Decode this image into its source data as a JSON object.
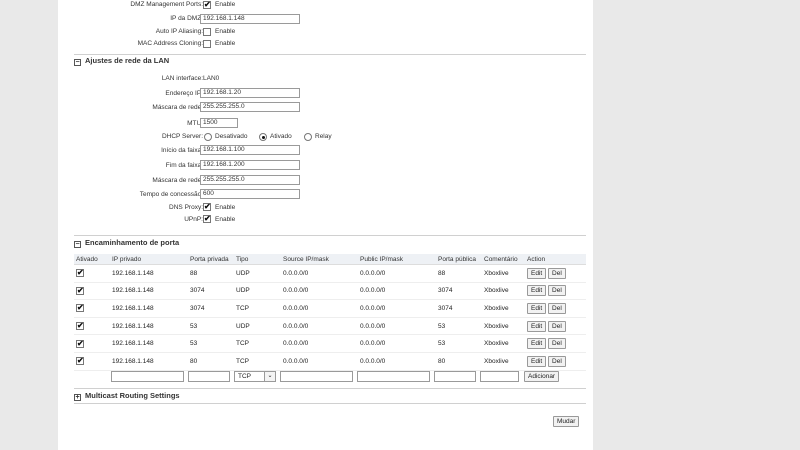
{
  "dmz": {
    "mgmt_label": "DMZ Management Ports:",
    "mgmt_enable": "Enable",
    "ip_label": "IP da DMZ:",
    "ip_value": "192.168.1.148",
    "auto_ip_label": "Auto IP Aliasing:",
    "auto_ip_enable": "Enable",
    "mac_label": "MAC Address Cloning:",
    "mac_enable": "Enable"
  },
  "lan": {
    "section_title": "Ajustes de rede da LAN",
    "interface_label": "LAN interface:",
    "interface_value": "LAN0",
    "ip_label": "Endereço IP:",
    "ip_value": "192.168.1.20",
    "mask_label": "Máscara de rede:",
    "mask_value": "255.255.255.0",
    "mtu_label": "MTU:",
    "mtu_value": "1500",
    "dhcp_label": "DHCP Server:",
    "dhcp_options": [
      "Desativado",
      "Ativado",
      "Relay"
    ],
    "dhcp_selected": "Ativado",
    "start_label": "Início da faixa:",
    "start_value": "192.168.1.100",
    "end_label": "Fim da faixa:",
    "end_value": "192.168.1.200",
    "dhcp_mask_label": "Máscara de rede:",
    "dhcp_mask_value": "255.255.255.0",
    "lease_label": "Tempo de concessão:",
    "lease_value": "600",
    "dns_label": "DNS Proxy:",
    "dns_enable": "Enable",
    "upnp_label": "UPnP:",
    "upnp_enable": "Enable"
  },
  "portfwd": {
    "section_title": "Encaminhamento de porta",
    "headers": [
      "Ativado",
      "IP privado",
      "Porta privada",
      "Tipo",
      "Source IP/mask",
      "Public IP/mask",
      "Porta pública",
      "Comentário",
      "Action"
    ],
    "rows": [
      {
        "ip": "192.168.1.148",
        "priv_port": "88",
        "type": "UDP",
        "src": "0.0.0.0/0",
        "pub": "0.0.0.0/0",
        "pub_port": "88",
        "comment": "Xboxlive",
        "edit": "Edit",
        "del": "Del"
      },
      {
        "ip": "192.168.1.148",
        "priv_port": "3074",
        "type": "UDP",
        "src": "0.0.0.0/0",
        "pub": "0.0.0.0/0",
        "pub_port": "3074",
        "comment": "Xboxlive",
        "edit": "Edit",
        "del": "Del"
      },
      {
        "ip": "192.168.1.148",
        "priv_port": "3074",
        "type": "TCP",
        "src": "0.0.0.0/0",
        "pub": "0.0.0.0/0",
        "pub_port": "3074",
        "comment": "Xboxlive",
        "edit": "Edit",
        "del": "Del"
      },
      {
        "ip": "192.168.1.148",
        "priv_port": "53",
        "type": "UDP",
        "src": "0.0.0.0/0",
        "pub": "0.0.0.0/0",
        "pub_port": "53",
        "comment": "Xboxlive",
        "edit": "Edit",
        "del": "Del"
      },
      {
        "ip": "192.168.1.148",
        "priv_port": "53",
        "type": "TCP",
        "src": "0.0.0.0/0",
        "pub": "0.0.0.0/0",
        "pub_port": "53",
        "comment": "Xboxlive",
        "edit": "Edit",
        "del": "Del"
      },
      {
        "ip": "192.168.1.148",
        "priv_port": "80",
        "type": "TCP",
        "src": "0.0.0.0/0",
        "pub": "0.0.0.0/0",
        "pub_port": "80",
        "comment": "Xboxlive",
        "edit": "Edit",
        "del": "Del"
      }
    ],
    "new_type": "TCP",
    "add_label": "Adicionar"
  },
  "multicast": {
    "section_title": "Multicast Routing Settings"
  },
  "footer": {
    "submit_label": "Mudar"
  },
  "icons": {
    "check": "✔",
    "collapse": "−",
    "expand": "+",
    "dropdown": "⌄"
  }
}
